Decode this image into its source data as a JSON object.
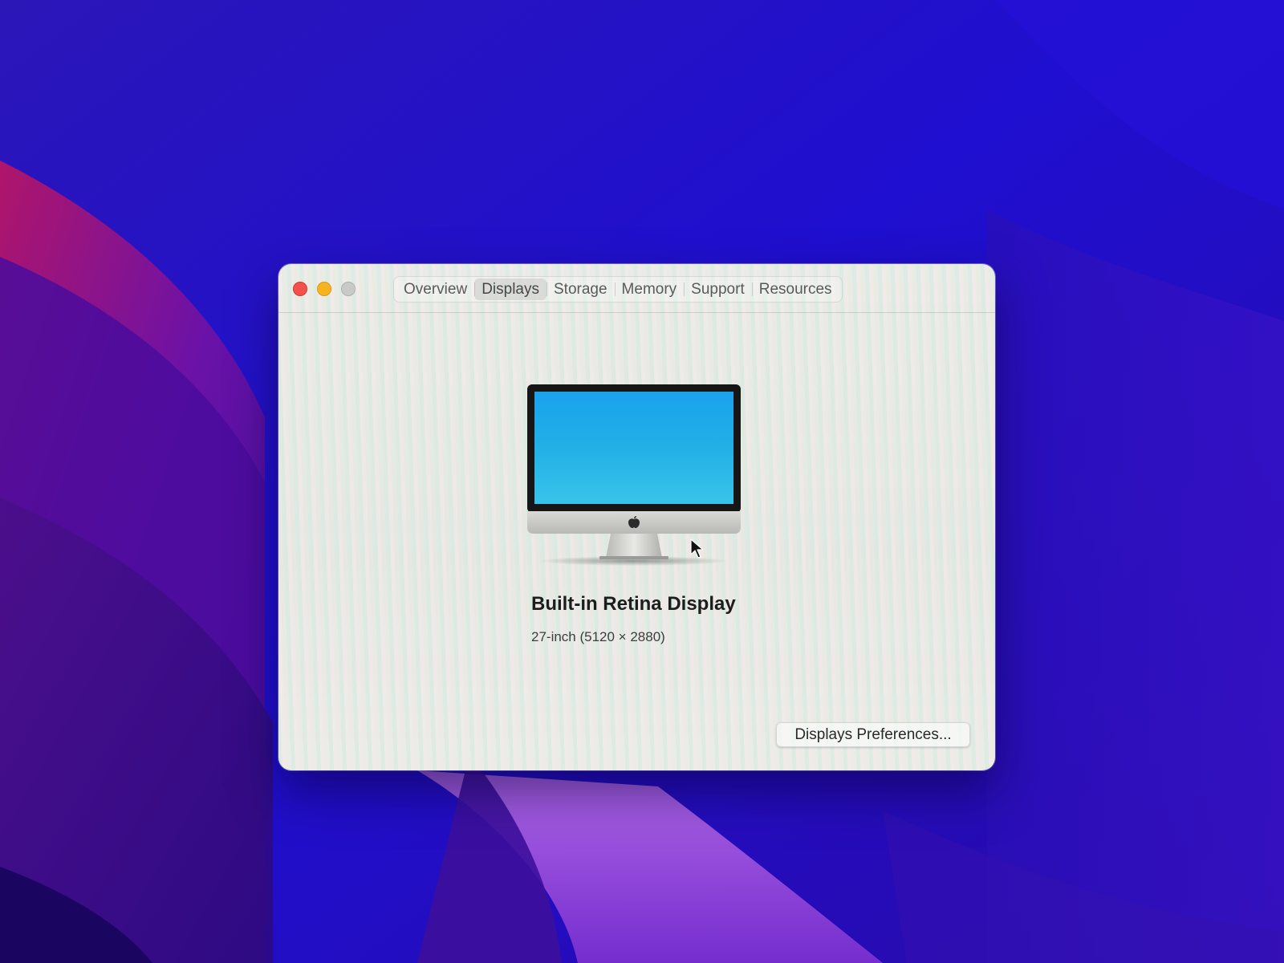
{
  "window": {
    "tabs": [
      {
        "label": "Overview",
        "active": false
      },
      {
        "label": "Displays",
        "active": true
      },
      {
        "label": "Storage",
        "active": false
      },
      {
        "label": "Memory",
        "active": false
      },
      {
        "label": "Support",
        "active": false
      },
      {
        "label": "Resources",
        "active": false
      }
    ],
    "traffic_lights": {
      "close_color": "#f2524a",
      "minimize_color": "#f8b41f",
      "zoom_color": "#c9c9c6"
    }
  },
  "display": {
    "icon": "imac-icon",
    "name": "Built-in Retina Display",
    "spec": "27-inch (5120 × 2880)"
  },
  "buttons": {
    "preferences_label": "Displays Preferences..."
  },
  "colors": {
    "desktop_blue": "#2a0fc4",
    "desktop_purple": "#5a1ab0",
    "screen_blue": "#22a8e8"
  }
}
